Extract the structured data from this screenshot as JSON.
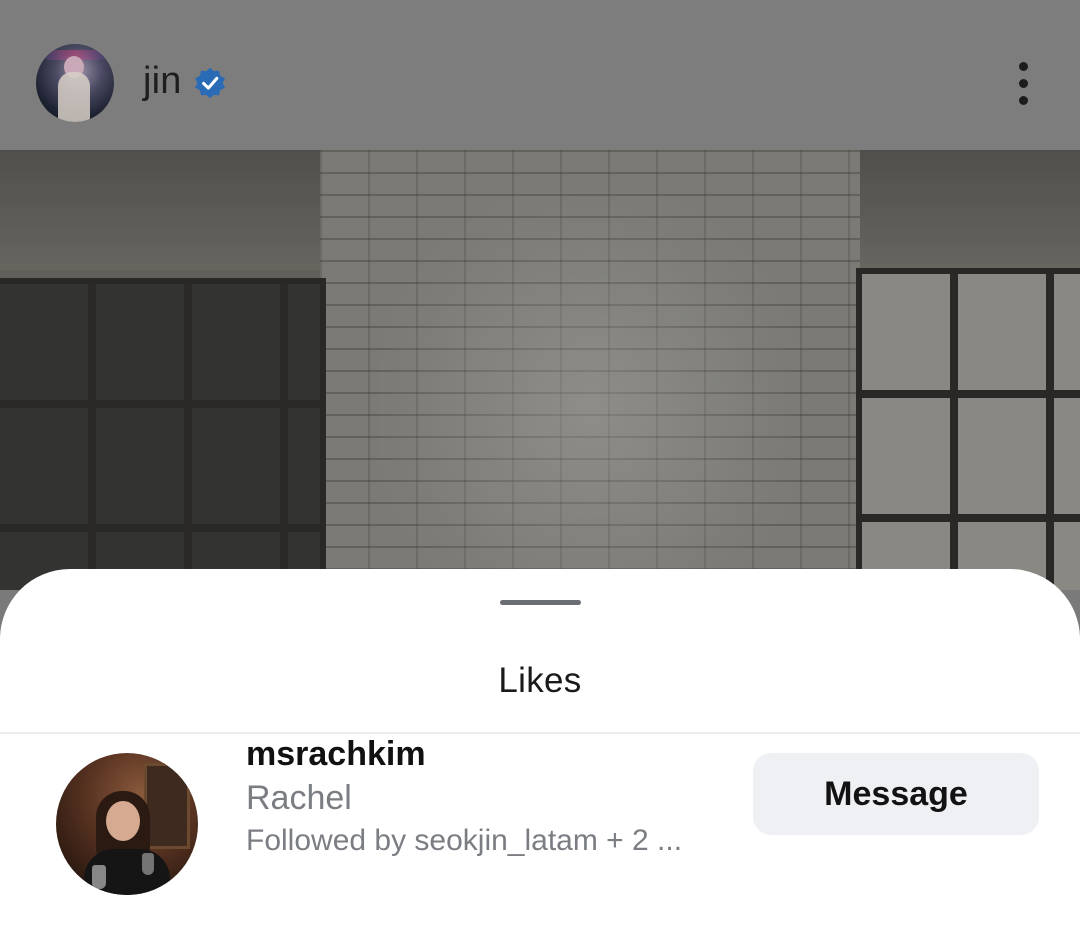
{
  "header": {
    "username": "jin",
    "verified": true,
    "avatar_icon": "profile-photo",
    "more_icon": "more-vertical-icon"
  },
  "sheet": {
    "title": "Likes"
  },
  "likes": [
    {
      "username": "msrachkim",
      "full_name": "Rachel",
      "followed_by": "Followed by seokjin_latam + 2 ...",
      "button_label": "Message"
    }
  ],
  "colors": {
    "verified_badge": "#2a6bb5",
    "button_bg": "#eff0f4",
    "secondary_text": "#7a7d82"
  }
}
